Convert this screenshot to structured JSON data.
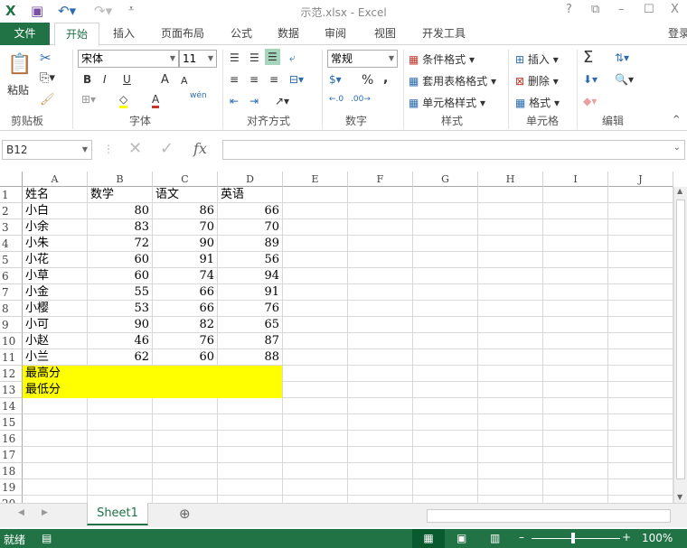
{
  "window": {
    "title": "示范.xlsx - Excel",
    "help": "?",
    "restore_ribbon": "⧉",
    "minimize": "–",
    "maximize": "☐",
    "close": "X"
  },
  "tabs": [
    "文件",
    "开始",
    "插入",
    "页面布局",
    "公式",
    "数据",
    "审阅",
    "视图",
    "开发工具"
  ],
  "login": "登录",
  "ribbon": {
    "clipboard": {
      "paste": "粘贴",
      "label": "剪贴板"
    },
    "font": {
      "name": "宋体",
      "size": "11",
      "bold": "B",
      "italic": "I",
      "underline": "U",
      "grow": "A",
      "shrink": "A",
      "color_a": "A",
      "phonetic": "wén",
      "label": "字体"
    },
    "align": {
      "label": "对齐方式"
    },
    "number": {
      "format": "常规",
      "percent": "%",
      "comma": ",",
      "label": "数字"
    },
    "styles": {
      "cond": "条件格式",
      "table": "套用表格格式",
      "cell": "单元格样式",
      "label": "样式"
    },
    "cells": {
      "insert": "插入",
      "delete": "删除",
      "format": "格式",
      "label": "单元格"
    },
    "editing": {
      "sum": "Σ",
      "label": "编辑"
    }
  },
  "formula_bar": {
    "name_box": "B12",
    "fx": "fx",
    "value": ""
  },
  "columns": [
    "A",
    "B",
    "C",
    "D",
    "E",
    "F",
    "G",
    "H",
    "I",
    "J"
  ],
  "rows": [
    [
      "姓名",
      "数学",
      "语文",
      "英语"
    ],
    [
      "小白",
      80,
      86,
      66
    ],
    [
      "小余",
      83,
      70,
      70
    ],
    [
      "小朱",
      72,
      90,
      89
    ],
    [
      "小花",
      60,
      91,
      56
    ],
    [
      "小草",
      60,
      74,
      94
    ],
    [
      "小金",
      55,
      66,
      91
    ],
    [
      "小樱",
      53,
      66,
      76
    ],
    [
      "小可",
      90,
      82,
      65
    ],
    [
      "小赵",
      46,
      76,
      87
    ],
    [
      "小兰",
      62,
      60,
      88
    ],
    [
      "最高分",
      "",
      "",
      ""
    ],
    [
      "最低分",
      "",
      "",
      ""
    ]
  ],
  "row_count": 20,
  "highlight_color": "#ffff00",
  "sheets": [
    "Sheet1"
  ],
  "status": {
    "ready": "就绪",
    "zoom": "100%"
  }
}
